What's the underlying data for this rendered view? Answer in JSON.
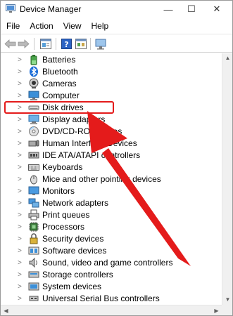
{
  "window": {
    "title": "Device Manager",
    "icon": "device-manager-icon",
    "buttons": {
      "minimize": "—",
      "maximize": "☐",
      "close": "✕"
    }
  },
  "menu": [
    "File",
    "Action",
    "View",
    "Help"
  ],
  "toolbar": [
    "back-arrow-icon",
    "forward-arrow-icon",
    "properties-icon",
    "help-icon",
    "update-driver-icon",
    "scan-monitor-icon"
  ],
  "tree": {
    "items": [
      {
        "label": "Batteries",
        "icon": "battery-icon"
      },
      {
        "label": "Bluetooth",
        "icon": "bluetooth-icon"
      },
      {
        "label": "Cameras",
        "icon": "camera-icon"
      },
      {
        "label": "Computer",
        "icon": "computer-icon"
      },
      {
        "label": "Disk drives",
        "icon": "disk-drive-icon"
      },
      {
        "label": "Display adapters",
        "icon": "display-adapter-icon"
      },
      {
        "label": "DVD/CD-ROM drives",
        "icon": "dvd-drive-icon"
      },
      {
        "label": "Human Interface Devices",
        "icon": "hid-icon"
      },
      {
        "label": "IDE ATA/ATAPI controllers",
        "icon": "ide-controller-icon"
      },
      {
        "label": "Keyboards",
        "icon": "keyboard-icon"
      },
      {
        "label": "Mice and other pointing devices",
        "icon": "mouse-icon"
      },
      {
        "label": "Monitors",
        "icon": "monitor-icon"
      },
      {
        "label": "Network adapters",
        "icon": "network-adapter-icon"
      },
      {
        "label": "Print queues",
        "icon": "printer-icon"
      },
      {
        "label": "Processors",
        "icon": "processor-icon"
      },
      {
        "label": "Security devices",
        "icon": "security-device-icon"
      },
      {
        "label": "Software devices",
        "icon": "software-device-icon"
      },
      {
        "label": "Sound, video and game controllers",
        "icon": "sound-icon"
      },
      {
        "label": "Storage controllers",
        "icon": "storage-controller-icon"
      },
      {
        "label": "System devices",
        "icon": "system-device-icon"
      },
      {
        "label": "Universal Serial Bus controllers",
        "icon": "usb-icon"
      }
    ]
  },
  "annotation": {
    "highlighted_item": "Disk drives",
    "color": "#e41b1b"
  }
}
